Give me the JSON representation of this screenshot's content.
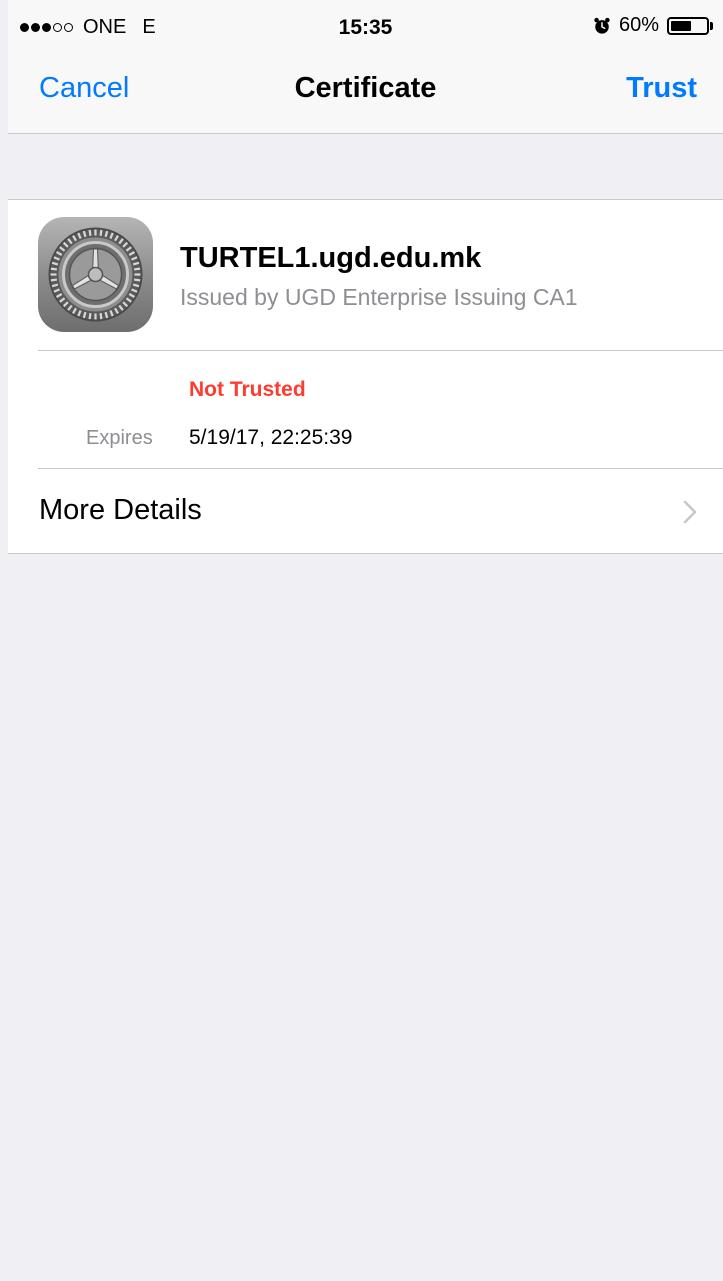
{
  "status_bar": {
    "carrier": "ONE",
    "network": "E",
    "time": "15:35",
    "battery_percent_text": "60%",
    "battery_level": 0.6,
    "signal_bars_filled": 3,
    "signal_bars_total": 5,
    "icons": {
      "alarm": "alarm-clock-icon",
      "battery": "battery-icon"
    }
  },
  "nav": {
    "cancel_label": "Cancel",
    "title": "Certificate",
    "trust_label": "Trust"
  },
  "certificate": {
    "icon": "settings-gear-icon",
    "name": "TURTEL1.ugd.edu.mk",
    "issuer": "Issued by UGD Enterprise Issuing CA1",
    "trust_status": "Not Trusted",
    "expires_label": "Expires",
    "expires_value": "5/19/17, 22:25:39"
  },
  "more_details": {
    "label": "More Details",
    "icon": "chevron-right-icon"
  },
  "colors": {
    "accent": "#007aff",
    "warning": "#ff3b30",
    "secondary_text": "#8e8e93",
    "background": "#efeff4"
  }
}
